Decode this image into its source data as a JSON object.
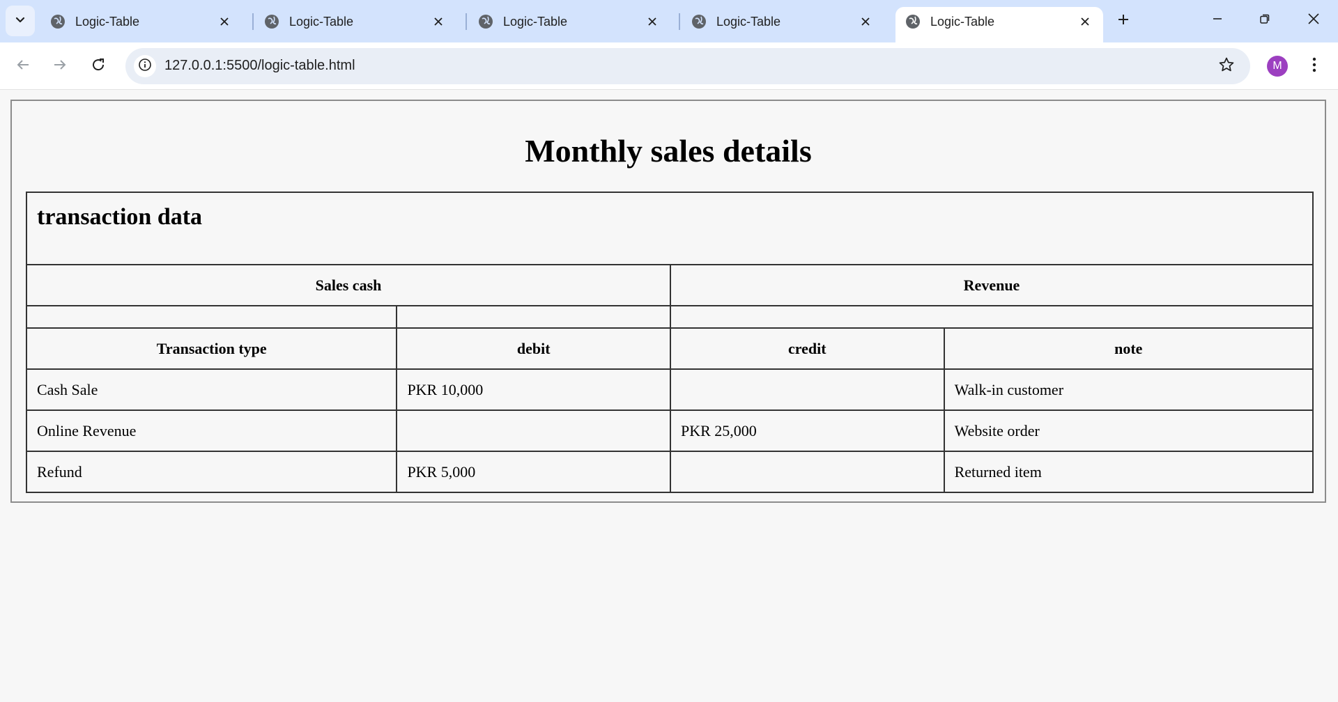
{
  "browser": {
    "tabs": [
      {
        "title": "Logic-Table"
      },
      {
        "title": "Logic-Table"
      },
      {
        "title": "Logic-Table"
      },
      {
        "title": "Logic-Table"
      },
      {
        "title": "Logic-Table",
        "active": true
      }
    ],
    "address": {
      "url": "127.0.0.1:5500/logic-table.html"
    },
    "profile": {
      "initial": "M",
      "color": "#9c3fc0"
    },
    "accent_color": "#d3e3fd",
    "icons": [
      "tab-search-icon",
      "globe-icon",
      "close-icon",
      "plus-icon",
      "minimize-icon",
      "restore-icon",
      "window-close-icon",
      "back-arrow-icon",
      "forward-arrow-icon",
      "reload-icon",
      "info-icon",
      "star-icon",
      "more-vertical-icon"
    ]
  },
  "page": {
    "heading": "Monthly sales details",
    "table": {
      "caption": "transaction data",
      "groups": {
        "sales_cash": "Sales cash",
        "revenue": "Revenue"
      },
      "columns": {
        "type": "Transaction type",
        "debit": "debit",
        "credit": "credit",
        "note": "note"
      },
      "rows": [
        {
          "type": "Cash Sale",
          "debit": "PKR 10,000",
          "credit": "",
          "note": "Walk-in customer"
        },
        {
          "type": "Online Revenue",
          "debit": "",
          "credit": "PKR 25,000",
          "note": "Website order"
        },
        {
          "type": "Refund",
          "debit": "PKR 5,000",
          "credit": "",
          "note": "Returned item"
        }
      ]
    }
  }
}
